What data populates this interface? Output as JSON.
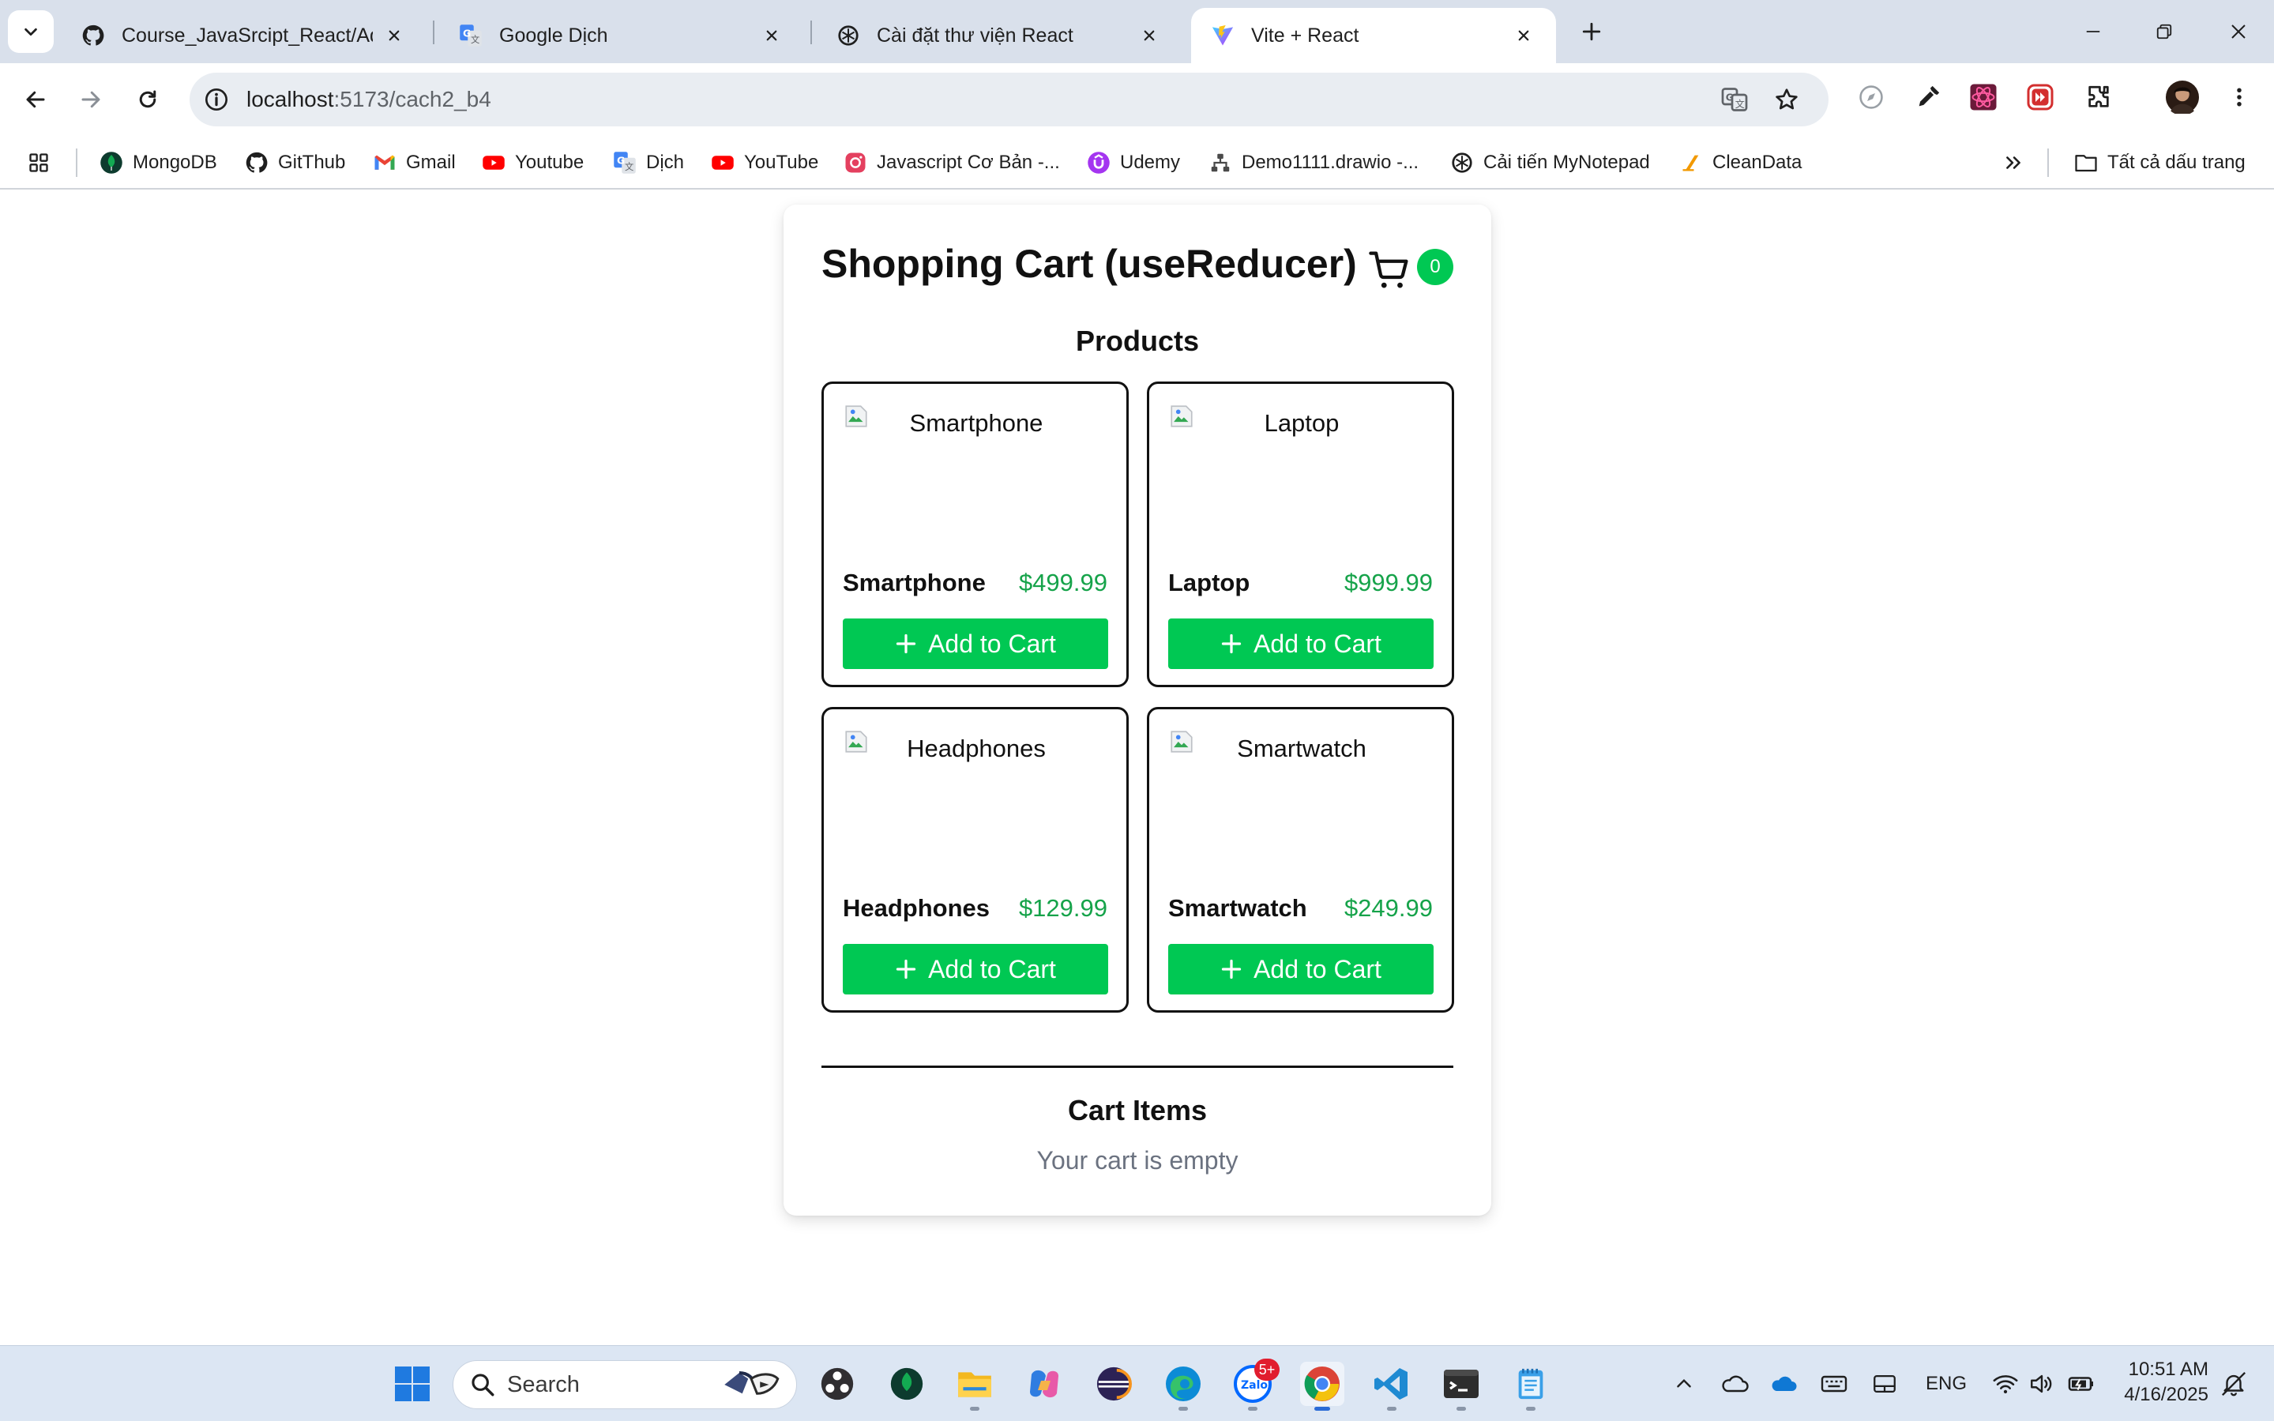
{
  "browser": {
    "tabs": [
      {
        "title": "Course_JavaSrcipt_React/Admin",
        "icon": "github-icon",
        "active": false
      },
      {
        "title": "Google Dịch",
        "icon": "google-translate-icon",
        "active": false
      },
      {
        "title": "Cài đặt thư viện React",
        "icon": "openai-icon",
        "active": false
      },
      {
        "title": "Vite + React",
        "icon": "vite-icon",
        "active": true
      }
    ],
    "url": {
      "host": "localhost",
      "path": ":5173/cach2_b4"
    },
    "bookmarks": [
      {
        "label": "MongoDB",
        "icon": "mongodb-icon"
      },
      {
        "label": "GitThub",
        "icon": "github-icon"
      },
      {
        "label": "Gmail",
        "icon": "gmail-icon"
      },
      {
        "label": "Youtube",
        "icon": "youtube-icon"
      },
      {
        "label": "Dịch",
        "icon": "google-translate-icon"
      },
      {
        "label": "YouTube",
        "icon": "youtube-icon"
      },
      {
        "label": "Javascript Cơ Bản -...",
        "icon": "bookmark-icon"
      },
      {
        "label": "Udemy",
        "icon": "udemy-icon"
      },
      {
        "label": "Demo1111.drawio -...",
        "icon": "drawio-icon"
      },
      {
        "label": "Cải tiến MyNotepad",
        "icon": "openai-icon"
      },
      {
        "label": "CleanData",
        "icon": "bookmark-icon"
      }
    ],
    "all_bookmarks_label": "Tất cả dấu trang"
  },
  "app": {
    "title": "Shopping Cart (useReducer)",
    "cart_count": "0",
    "products_heading": "Products",
    "add_to_cart_label": "Add to Cart",
    "products": [
      {
        "name": "Smartphone",
        "price": "$499.99",
        "image_alt": "Smartphone"
      },
      {
        "name": "Laptop",
        "price": "$999.99",
        "image_alt": "Laptop"
      },
      {
        "name": "Headphones",
        "price": "$129.99",
        "image_alt": "Headphones"
      },
      {
        "name": "Smartwatch",
        "price": "$249.99",
        "image_alt": "Smartwatch"
      }
    ],
    "cart_heading": "Cart Items",
    "cart_empty_text": "Your cart is empty"
  },
  "taskbar": {
    "search_placeholder": "Search",
    "notification_badge": "5+",
    "language": "ENG",
    "time": "10:51 AM",
    "date": "4/16/2025"
  },
  "colors": {
    "accent_green": "#00c853",
    "price_green": "#16a34a",
    "muted_text": "#6b7280"
  }
}
